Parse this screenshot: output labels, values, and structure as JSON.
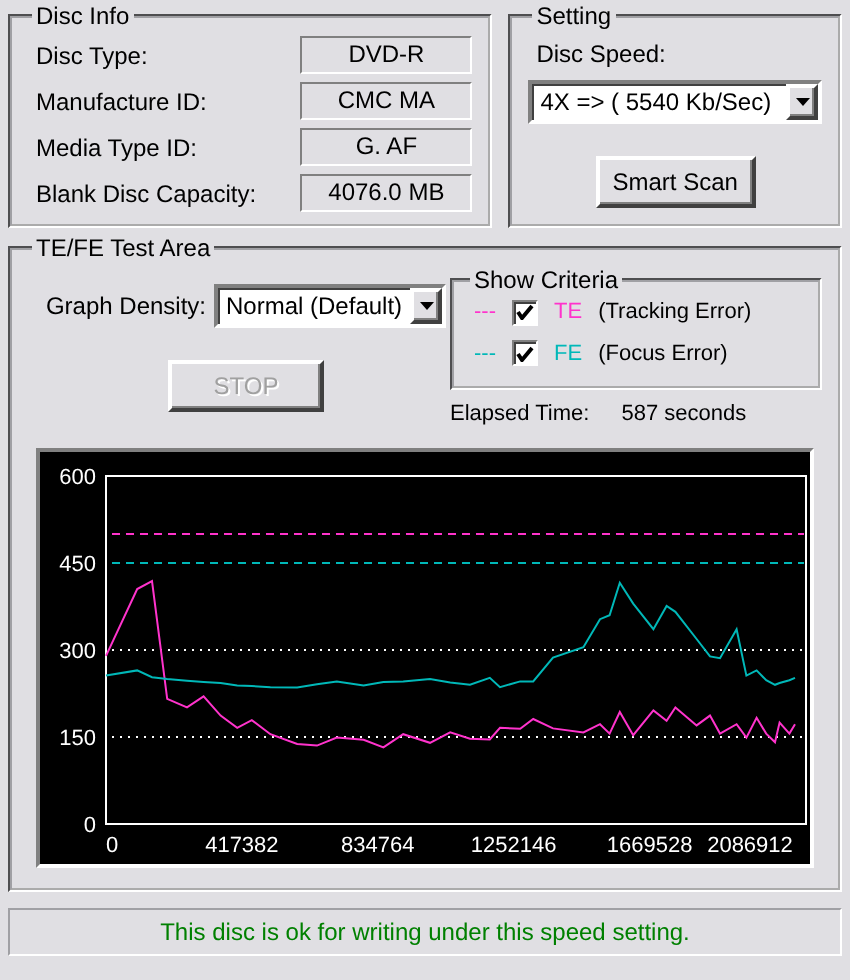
{
  "disc_info": {
    "title": "Disc Info",
    "fields": [
      {
        "label": "Disc Type:",
        "value": "DVD-R"
      },
      {
        "label": "Manufacture ID:",
        "value": "CMC MA"
      },
      {
        "label": "Media Type ID:",
        "value": "G. AF"
      },
      {
        "label": "Blank Disc Capacity:",
        "value": "4076.0 MB"
      }
    ]
  },
  "setting": {
    "title": "Setting",
    "speed_label": "Disc Speed:",
    "speed_value": "4X => ( 5540 Kb/Sec)",
    "button": "Smart Scan"
  },
  "test_area": {
    "title": "TE/FE Test Area",
    "density_label": "Graph Density:",
    "density_value": "Normal (Default)",
    "stop_button": {
      "label": "STOP",
      "disabled": true
    },
    "criteria": {
      "title": "Show Criteria",
      "items": [
        {
          "legend": "---",
          "description": "(Tracking Error)",
          "checked": true
        },
        {
          "legend": "---",
          "description": "(Focus Error)",
          "checked": true
        }
      ]
    },
    "elapsed_label": "Elapsed Time:",
    "elapsed_value": "587 seconds",
    "chart_data": {
      "type": "line",
      "x": [
        0,
        96000,
        141000,
        188000,
        249000,
        300000,
        352000,
        403000,
        448000,
        505000,
        587000,
        648000,
        709000,
        791000,
        852000,
        913000,
        995000,
        1057000,
        1118000,
        1179000,
        1210000,
        1272000,
        1312000,
        1373000,
        1466000,
        1517000,
        1547000,
        1578000,
        1619000,
        1681000,
        1722000,
        1749000,
        1814000,
        1855000,
        1886000,
        1937000,
        1967000,
        1998000,
        2028000,
        2055000,
        2069000,
        2099000,
        2116000
      ],
      "series": [
        {
          "name": "TE",
          "color": "#ff33cc",
          "values": [
            290,
            405,
            419,
            216,
            201,
            220,
            187,
            166,
            179,
            155,
            138,
            135,
            149,
            145,
            132,
            155,
            140,
            158,
            147,
            146,
            166,
            164,
            181,
            165,
            158,
            172,
            156,
            193,
            153,
            196,
            178,
            201,
            170,
            187,
            156,
            172,
            149,
            183,
            156,
            141,
            175,
            156,
            172
          ]
        },
        {
          "name": "FE",
          "color": "#00b8b8",
          "values": [
            256,
            265,
            253,
            250,
            247,
            245,
            243,
            239,
            238,
            236,
            235,
            241,
            246,
            239,
            245,
            246,
            250,
            244,
            240,
            252,
            236,
            246,
            246,
            287,
            305,
            353,
            360,
            416,
            380,
            336,
            376,
            366,
            319,
            289,
            286,
            336,
            256,
            265,
            248,
            240,
            243,
            248,
            252
          ]
        }
      ],
      "xlim": [
        0,
        2150000
      ],
      "ylim": [
        0,
        600
      ],
      "xticks": [
        0,
        417382,
        834764,
        1252146,
        1669528,
        2086912
      ],
      "yticks": [
        0,
        150,
        300,
        450,
        600
      ],
      "ref_lines": [
        {
          "axis": "y",
          "value": 500,
          "color": "#ff33cc"
        },
        {
          "axis": "y",
          "value": 450,
          "color": "#00b8b8"
        },
        {
          "axis": "y",
          "value": 300,
          "color": "#ffffff"
        },
        {
          "axis": "y",
          "value": 150,
          "color": "#ffffff"
        }
      ]
    }
  },
  "status": "This disc is ok for writing under this speed setting."
}
